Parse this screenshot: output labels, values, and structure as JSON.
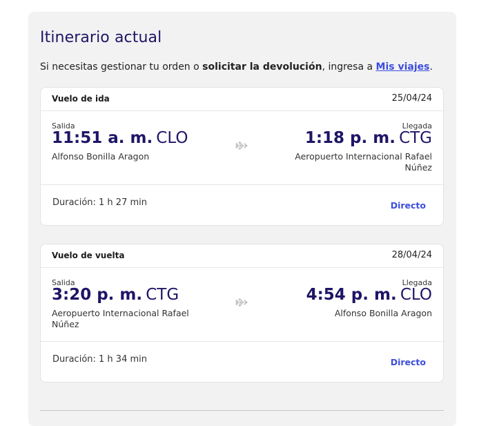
{
  "itinerary": {
    "title": "Itinerario actual",
    "intro_prefix": "Si necesitas gestionar tu orden o ",
    "intro_bold": "solicitar la devolución",
    "intro_middle": ", ingresa a ",
    "intro_link": "Mis viajes",
    "intro_suffix": "."
  },
  "flights": [
    {
      "label": "Vuelo de ida",
      "date": "25/04/24",
      "departure": {
        "label": "Salida",
        "time": "11:51 a. m.",
        "code": "CLO",
        "airport": "Alfonso Bonilla Aragon"
      },
      "arrival": {
        "label": "Llegada",
        "time": "1:18 p. m.",
        "code": "CTG",
        "airport": "Aeropuerto Internacional Rafael Núñez"
      },
      "duration": "Duración: 1 h 27 min",
      "stops": "Directo"
    },
    {
      "label": "Vuelo de vuelta",
      "date": "28/04/24",
      "departure": {
        "label": "Salida",
        "time": "3:20 p. m.",
        "code": "CTG",
        "airport": "Aeropuerto Internacional Rafael Núñez"
      },
      "arrival": {
        "label": "Llegada",
        "time": "4:54 p. m.",
        "code": "CLO",
        "airport": "Alfonso Bonilla Aragon"
      },
      "duration": "Duración: 1 h 34 min",
      "stops": "Directo"
    }
  ],
  "colors": {
    "brand_navy": "#1e1566",
    "link_blue": "#3b4ddd",
    "panel_bg": "#f2f2f2"
  },
  "icons": {
    "plane": "plane-icon"
  }
}
